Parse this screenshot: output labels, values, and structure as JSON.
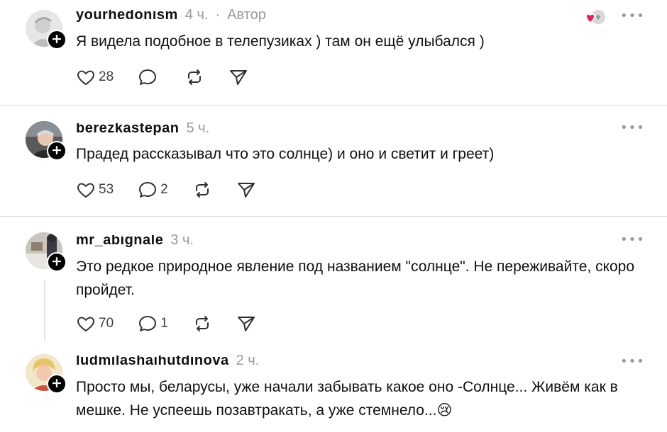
{
  "posts": [
    {
      "username": "yourhedonism",
      "time": "4 ч.",
      "separator": "·",
      "author_tag": "Автор",
      "text": "Я видела подобное в телепузиках ) там он ещё улыбался )",
      "likes": "28",
      "replies": "",
      "liked_by_author": true
    },
    {
      "username": "berezkastepan",
      "time": "5 ч.",
      "text": "Прадед рассказывал что это солнце) и оно и светит и греет)",
      "likes": "53",
      "replies": "2"
    },
    {
      "username": "mr_abignale",
      "time": "3 ч.",
      "text": "Это редкое природное явление под названием \"солнце\". Не переживайте, скоро пройдет.",
      "likes": "70",
      "replies": "1"
    },
    {
      "username": "ludmilashaihutdinova",
      "time": "2 ч.",
      "text": "Просто мы, беларусы, уже начали забывать какое оно -Солнце... Живём как в мешке. Не успеешь позавтракать, а уже стемнело...😢"
    }
  ],
  "icons": {
    "like": "heart-icon",
    "reply": "comment-bubble-icon",
    "repost": "repost-icon",
    "share": "send-icon",
    "more": "more-dots-icon",
    "follow": "plus-icon"
  },
  "colors": {
    "text": "#101010",
    "muted": "#9a9a9a",
    "divider": "#dcdcdc",
    "liked_heart": "#e0245e"
  }
}
